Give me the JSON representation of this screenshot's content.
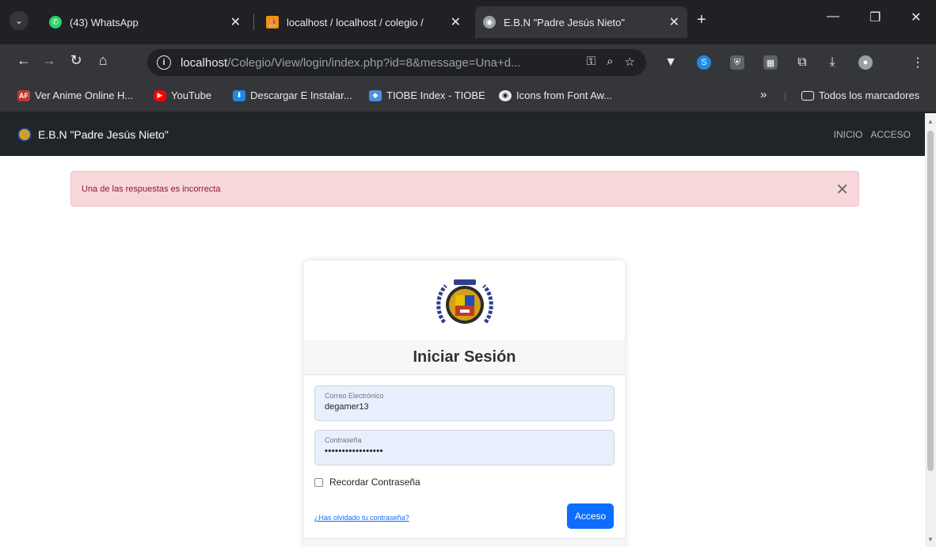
{
  "browser": {
    "tabs": [
      {
        "title": "(43) WhatsApp",
        "close": "✕"
      },
      {
        "title": "localhost / localhost / colegio /",
        "close": "✕"
      },
      {
        "title": "E.B.N \"Padre Jesús Nieto\"",
        "close": "✕"
      }
    ],
    "new_tab": "+",
    "url_host": "localhost",
    "url_rest": "/Colegio/View/login/index.php?id=8&message=Una+d...",
    "bookmarks": [
      {
        "label": "Ver Anime Online H...",
        "icon": "AF",
        "icon_color": "#c0392b"
      },
      {
        "label": "YouTube",
        "icon": "▶",
        "icon_color": "#ff0000"
      },
      {
        "label": "Descargar E Instalar...",
        "icon": "⬇",
        "icon_color": "#1e88e5"
      },
      {
        "label": "TIOBE Index - TIOBE",
        "icon": "◆",
        "icon_color": "#4a90e2"
      },
      {
        "label": "Icons from Font Aw...",
        "icon": "◉",
        "icon_color": "#333333"
      }
    ],
    "bookmarks_overflow": "»",
    "all_bookmarks": "Todos los marcadores"
  },
  "site": {
    "brand": "E.B.N \"Padre Jesús Nieto\"",
    "nav": [
      "INICIO",
      "ACCESO"
    ]
  },
  "alert": {
    "message": "Una de las respuestas es incorrecta",
    "close": "✕"
  },
  "login": {
    "title": "Iniciar Sesión",
    "email_label": "Correo Electrónico",
    "email_value": "degamer13",
    "password_label": "Contraseña",
    "password_value": "•••••••••••••••••",
    "remember_label": "Recordar Contraseña",
    "forgot_link": "¿Has olvidado tu contraseña?",
    "submit_label": "Acceso"
  },
  "colors": {
    "alert_bg": "#f8d7da",
    "alert_text": "#842029",
    "primary": "#0d6efd",
    "navbar": "#212529",
    "input_bg": "#e8f0fe"
  }
}
